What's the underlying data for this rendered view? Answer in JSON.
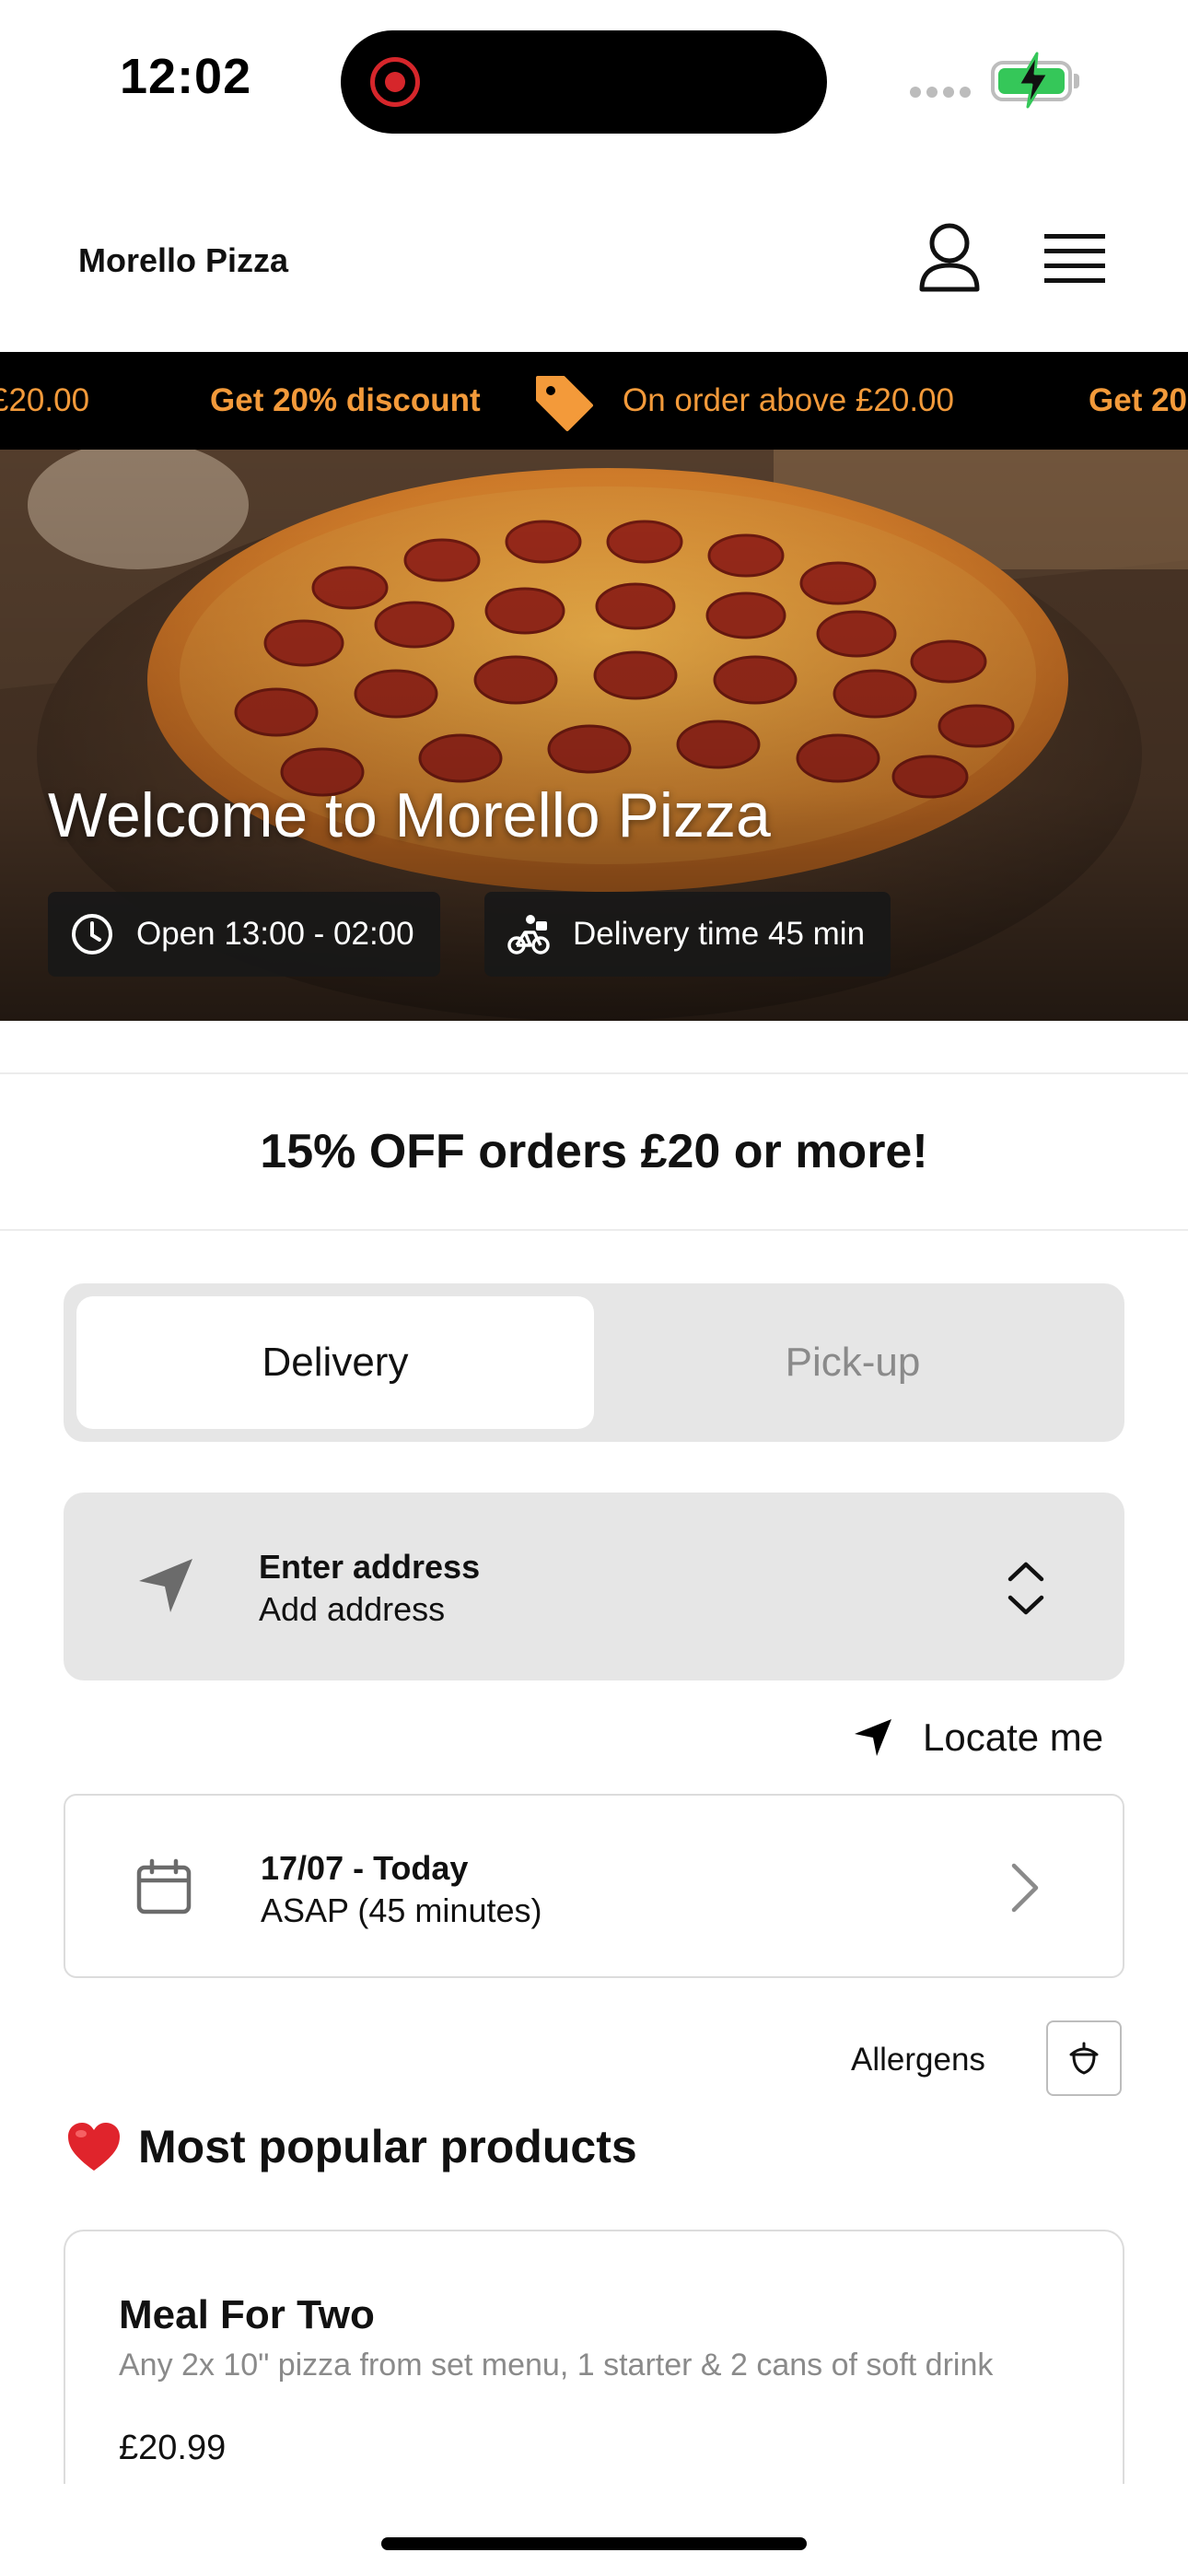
{
  "status_bar": {
    "time": "12:02"
  },
  "header": {
    "brand": "Morello Pizza"
  },
  "ticker": {
    "items": [
      "£20.00",
      "Get 20% discount",
      "On order above £20.00",
      "Get 20"
    ]
  },
  "hero": {
    "title": "Welcome to Morello Pizza",
    "hours": "Open 13:00 - 02:00",
    "delivery_time": "Delivery time 45 min"
  },
  "discount_banner": "15% OFF orders £20 or more!",
  "service_toggle": {
    "delivery": "Delivery",
    "pickup": "Pick-up",
    "selected": "Delivery"
  },
  "address": {
    "title": "Enter address",
    "subtitle": "Add address"
  },
  "locate": {
    "label": "Locate me"
  },
  "schedule": {
    "date": "17/07 - Today",
    "time": "ASAP (45 minutes)"
  },
  "allergens": {
    "label": "Allergens"
  },
  "popular": {
    "title": "Most popular products",
    "products": [
      {
        "name": "Meal For Two",
        "description": "Any 2x 10\" pizza from set menu, 1 starter & 2 cans of soft drink",
        "price": "£20.99"
      }
    ]
  },
  "colors": {
    "accent_orange": "#f39a3a",
    "ticker_bg": "#000000",
    "panel_grey": "#e6e6e6"
  }
}
